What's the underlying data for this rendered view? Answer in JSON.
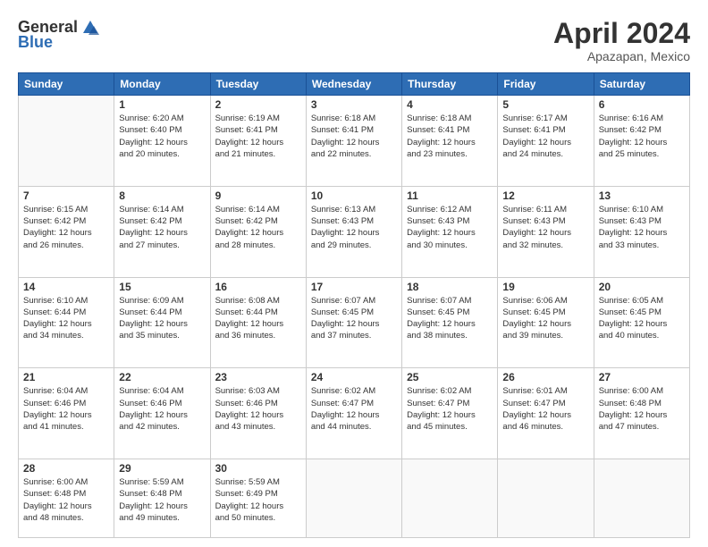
{
  "header": {
    "logo_general": "General",
    "logo_blue": "Blue",
    "month_title": "April 2024",
    "location": "Apazapan, Mexico"
  },
  "weekdays": [
    "Sunday",
    "Monday",
    "Tuesday",
    "Wednesday",
    "Thursday",
    "Friday",
    "Saturday"
  ],
  "days": [
    {
      "date": "",
      "info": ""
    },
    {
      "date": "1",
      "info": "Sunrise: 6:20 AM\nSunset: 6:40 PM\nDaylight: 12 hours\nand 20 minutes."
    },
    {
      "date": "2",
      "info": "Sunrise: 6:19 AM\nSunset: 6:41 PM\nDaylight: 12 hours\nand 21 minutes."
    },
    {
      "date": "3",
      "info": "Sunrise: 6:18 AM\nSunset: 6:41 PM\nDaylight: 12 hours\nand 22 minutes."
    },
    {
      "date": "4",
      "info": "Sunrise: 6:18 AM\nSunset: 6:41 PM\nDaylight: 12 hours\nand 23 minutes."
    },
    {
      "date": "5",
      "info": "Sunrise: 6:17 AM\nSunset: 6:41 PM\nDaylight: 12 hours\nand 24 minutes."
    },
    {
      "date": "6",
      "info": "Sunrise: 6:16 AM\nSunset: 6:42 PM\nDaylight: 12 hours\nand 25 minutes."
    },
    {
      "date": "7",
      "info": "Sunrise: 6:15 AM\nSunset: 6:42 PM\nDaylight: 12 hours\nand 26 minutes."
    },
    {
      "date": "8",
      "info": "Sunrise: 6:14 AM\nSunset: 6:42 PM\nDaylight: 12 hours\nand 27 minutes."
    },
    {
      "date": "9",
      "info": "Sunrise: 6:14 AM\nSunset: 6:42 PM\nDaylight: 12 hours\nand 28 minutes."
    },
    {
      "date": "10",
      "info": "Sunrise: 6:13 AM\nSunset: 6:43 PM\nDaylight: 12 hours\nand 29 minutes."
    },
    {
      "date": "11",
      "info": "Sunrise: 6:12 AM\nSunset: 6:43 PM\nDaylight: 12 hours\nand 30 minutes."
    },
    {
      "date": "12",
      "info": "Sunrise: 6:11 AM\nSunset: 6:43 PM\nDaylight: 12 hours\nand 32 minutes."
    },
    {
      "date": "13",
      "info": "Sunrise: 6:10 AM\nSunset: 6:43 PM\nDaylight: 12 hours\nand 33 minutes."
    },
    {
      "date": "14",
      "info": "Sunrise: 6:10 AM\nSunset: 6:44 PM\nDaylight: 12 hours\nand 34 minutes."
    },
    {
      "date": "15",
      "info": "Sunrise: 6:09 AM\nSunset: 6:44 PM\nDaylight: 12 hours\nand 35 minutes."
    },
    {
      "date": "16",
      "info": "Sunrise: 6:08 AM\nSunset: 6:44 PM\nDaylight: 12 hours\nand 36 minutes."
    },
    {
      "date": "17",
      "info": "Sunrise: 6:07 AM\nSunset: 6:45 PM\nDaylight: 12 hours\nand 37 minutes."
    },
    {
      "date": "18",
      "info": "Sunrise: 6:07 AM\nSunset: 6:45 PM\nDaylight: 12 hours\nand 38 minutes."
    },
    {
      "date": "19",
      "info": "Sunrise: 6:06 AM\nSunset: 6:45 PM\nDaylight: 12 hours\nand 39 minutes."
    },
    {
      "date": "20",
      "info": "Sunrise: 6:05 AM\nSunset: 6:45 PM\nDaylight: 12 hours\nand 40 minutes."
    },
    {
      "date": "21",
      "info": "Sunrise: 6:04 AM\nSunset: 6:46 PM\nDaylight: 12 hours\nand 41 minutes."
    },
    {
      "date": "22",
      "info": "Sunrise: 6:04 AM\nSunset: 6:46 PM\nDaylight: 12 hours\nand 42 minutes."
    },
    {
      "date": "23",
      "info": "Sunrise: 6:03 AM\nSunset: 6:46 PM\nDaylight: 12 hours\nand 43 minutes."
    },
    {
      "date": "24",
      "info": "Sunrise: 6:02 AM\nSunset: 6:47 PM\nDaylight: 12 hours\nand 44 minutes."
    },
    {
      "date": "25",
      "info": "Sunrise: 6:02 AM\nSunset: 6:47 PM\nDaylight: 12 hours\nand 45 minutes."
    },
    {
      "date": "26",
      "info": "Sunrise: 6:01 AM\nSunset: 6:47 PM\nDaylight: 12 hours\nand 46 minutes."
    },
    {
      "date": "27",
      "info": "Sunrise: 6:00 AM\nSunset: 6:48 PM\nDaylight: 12 hours\nand 47 minutes."
    },
    {
      "date": "28",
      "info": "Sunrise: 6:00 AM\nSunset: 6:48 PM\nDaylight: 12 hours\nand 48 minutes."
    },
    {
      "date": "29",
      "info": "Sunrise: 5:59 AM\nSunset: 6:48 PM\nDaylight: 12 hours\nand 49 minutes."
    },
    {
      "date": "30",
      "info": "Sunrise: 5:59 AM\nSunset: 6:49 PM\nDaylight: 12 hours\nand 50 minutes."
    },
    {
      "date": "",
      "info": ""
    },
    {
      "date": "",
      "info": ""
    },
    {
      "date": "",
      "info": ""
    },
    {
      "date": "",
      "info": ""
    }
  ]
}
